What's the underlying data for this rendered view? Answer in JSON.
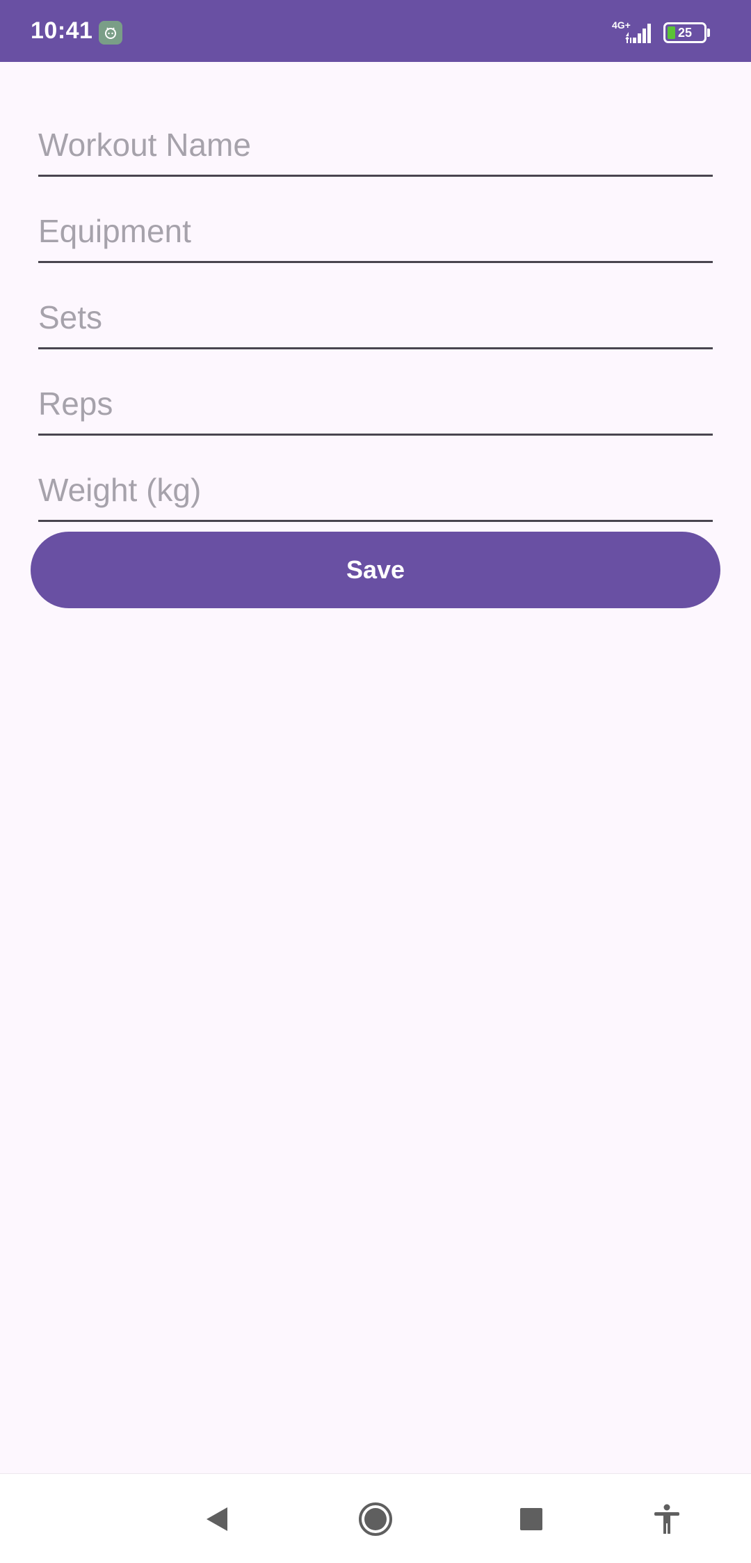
{
  "status_bar": {
    "time": "10:41",
    "network_type": "4G+",
    "battery_level": "25",
    "notification_icon": "android-app-icon",
    "signal_icon": "cellular-signal-icon",
    "battery_icon": "battery-icon"
  },
  "form": {
    "fields": [
      {
        "name": "workout-name",
        "placeholder": "Workout Name",
        "value": ""
      },
      {
        "name": "equipment",
        "placeholder": "Equipment",
        "value": ""
      },
      {
        "name": "sets",
        "placeholder": "Sets",
        "value": ""
      },
      {
        "name": "reps",
        "placeholder": "Reps",
        "value": ""
      },
      {
        "name": "weight",
        "placeholder": "Weight (kg)",
        "value": ""
      }
    ],
    "save_label": "Save"
  },
  "nav_bar": {
    "icons": [
      "back-icon",
      "home-icon",
      "recents-icon",
      "accessibility-icon"
    ]
  },
  "colors": {
    "primary": "#6950A3",
    "background": "#FDF7FE",
    "placeholder": "#A6A2AB",
    "underline": "#49454F",
    "battery_fill": "#5BC236"
  }
}
